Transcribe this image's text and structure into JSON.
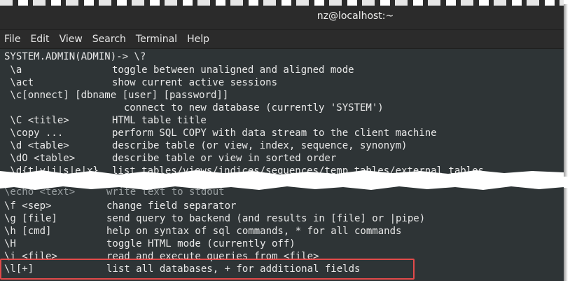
{
  "window": {
    "title": "nz@localhost:~"
  },
  "menu": [
    "File",
    "Edit",
    "View",
    "Search",
    "Terminal",
    "Help"
  ],
  "top_lines": [
    {
      "cmd": "SYSTEM.ADMIN(ADMIN)-> \\?",
      "desc": ""
    },
    {
      "cmd": " \\a",
      "desc": "toggle between unaligned and aligned mode"
    },
    {
      "cmd": " \\act",
      "desc": "show current active sessions"
    },
    {
      "cmd": " \\c[onnect] [dbname [user] [password]]",
      "desc": ""
    },
    {
      "cmd": "",
      "desc": "  connect to new database (currently 'SYSTEM')"
    },
    {
      "cmd": " \\C <title>",
      "desc": "HTML table title"
    },
    {
      "cmd": " \\copy ...",
      "desc": "perform SQL COPY with data stream to the client machine"
    },
    {
      "cmd": " \\d <table>",
      "desc": "describe table (or view, index, sequence, synonym)"
    },
    {
      "cmd": " \\dO <table>",
      "desc": "describe table or view in sorted order"
    },
    {
      "cmd": " \\d{t|v|i|s|e|x}",
      "desc": "list tables/views/indices/sequences/temp tables/external tables"
    }
  ],
  "bottom_lines": [
    {
      "cmd": "\\f <sep>",
      "desc": "change field separator"
    },
    {
      "cmd": "\\g [file]",
      "desc": "send query to backend (and results in [file] or |pipe)"
    },
    {
      "cmd": "\\h [cmd]",
      "desc": "help on syntax of sql commands, * for all commands"
    },
    {
      "cmd": "\\H",
      "desc": "toggle HTML mode (currently off)"
    },
    {
      "cmd": "\\i <file>",
      "desc": "read and execute queries from <file>"
    },
    {
      "cmd": "\\l[+]",
      "desc": "list all databases, + for additional fields"
    }
  ],
  "colors": {
    "terminal_bg": "#2e3436",
    "text": "#e8e8e8",
    "highlight_border": "#e24a4a"
  }
}
